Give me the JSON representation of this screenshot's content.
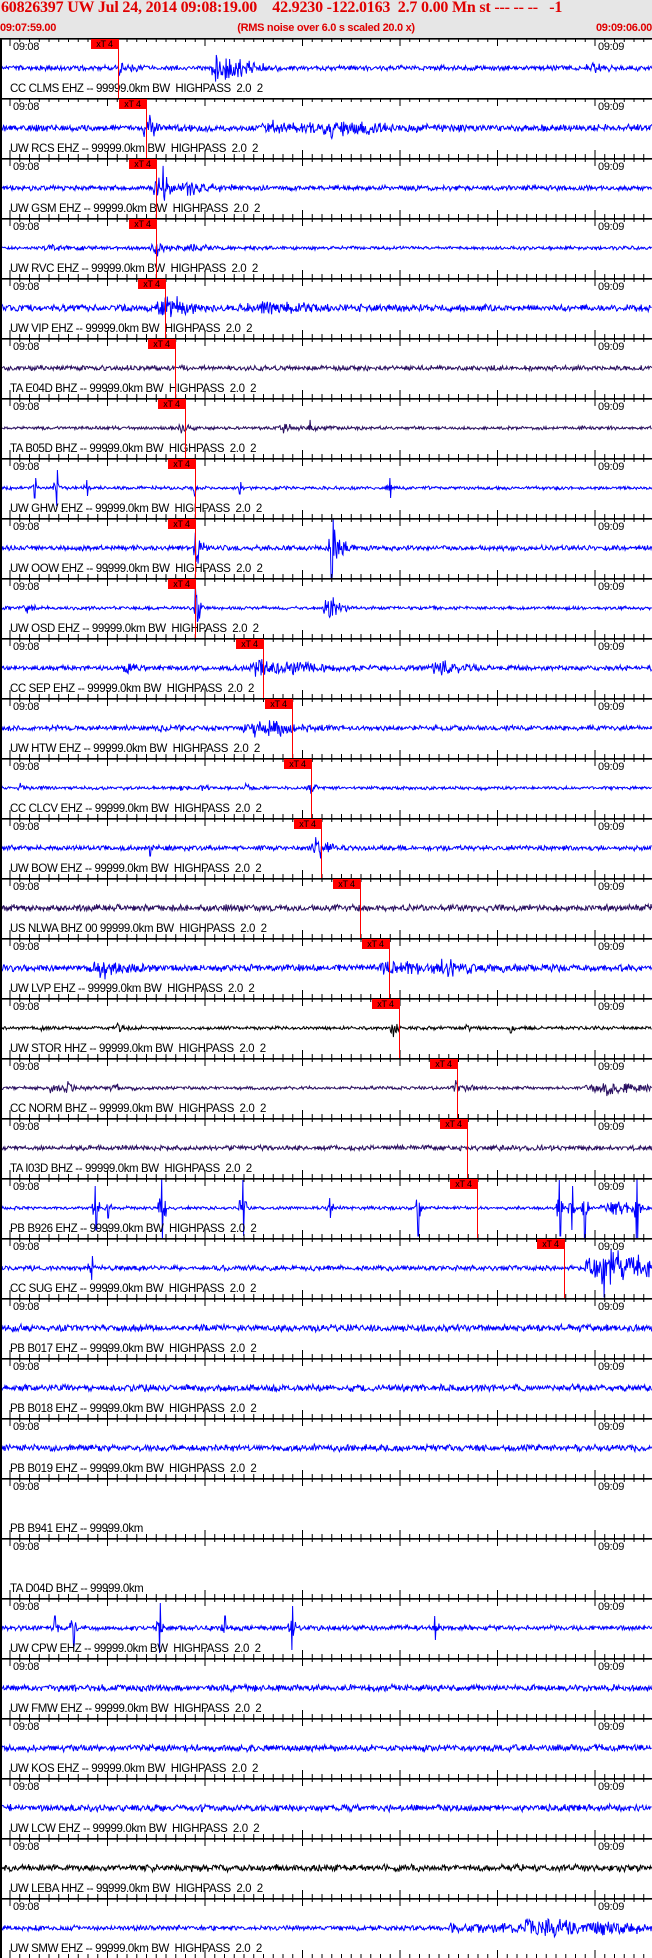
{
  "header": {
    "title": "60826397 UW Jul 24, 2014 09:08:19.00    42.9230 -122.0163  2.7 0.00 Mn st --- -- --   -1",
    "start_time": "09:07:59.00",
    "scaling_note": "(RMS noise over 6.0 s scaled 20.0 x)",
    "end_time": "09:09:06.00"
  },
  "axis": {
    "left_tick_label": "09:08",
    "right_tick_label": "09:09"
  },
  "pick_label": "xT 4",
  "colors": {
    "header_text": "#e00000",
    "header_bg": "#e6e6e6",
    "pick": "#ff0000",
    "blue_trace": "#0000ff",
    "purple_trace": "#2a1060",
    "black_trace": "#000000"
  },
  "stations": [
    {
      "label": "CC CLMS EHZ -- 99999.0km BW  HIGHPASS  2.0  2",
      "trace_color": "#0000ff",
      "pick_time": "09:08:11.1"
    },
    {
      "label": "UW RCS EHZ -- 99999.0km BW  HIGHPASS  2.0  2",
      "trace_color": "#0000ff",
      "pick_time": "09:08:14.0"
    },
    {
      "label": "UW GSM EHZ -- 99999.0km BW  HIGHPASS  2.0  2",
      "trace_color": "#0000ff",
      "pick_time": "09:08:15.0"
    },
    {
      "label": "UW RVC EHZ -- 99999.0km BW  HIGHPASS  2.0  2",
      "trace_color": "#0000ff",
      "pick_time": "09:08:15.0"
    },
    {
      "label": "UW VIP EHZ -- 99999.0km BW  HIGHPASS  2.0  2",
      "trace_color": "#0000ff",
      "pick_time": "09:08:15.9"
    },
    {
      "label": "TA E04D BHZ -- 99999.0km BW  HIGHPASS  2.0  2",
      "trace_color": "#2a1060",
      "pick_time": "09:08:16.9"
    },
    {
      "label": "TA B05D BHZ -- 99999.0km BW  HIGHPASS  2.0  2",
      "trace_color": "#2a1060",
      "pick_time": "09:08:18.0"
    },
    {
      "label": "UW GHW EHZ -- 99999.0km BW  HIGHPASS  2.0  2",
      "trace_color": "#0000ff",
      "pick_time": "09:08:19.0"
    },
    {
      "label": "UW OOW EHZ -- 99999.0km BW  HIGHPASS  2.0  2",
      "trace_color": "#0000ff",
      "pick_time": "09:08:19.0"
    },
    {
      "label": "UW OSD EHZ -- 99999.0km BW  HIGHPASS  2.0  2",
      "trace_color": "#0000ff",
      "pick_time": "09:08:19.0"
    },
    {
      "label": "CC SEP EHZ -- 99999.0km BW  HIGHPASS  2.0  2",
      "trace_color": "#0000ff",
      "pick_time": "09:08:26.0"
    },
    {
      "label": "UW HTW EHZ -- 99999.0km BW  HIGHPASS  2.0  2",
      "trace_color": "#0000ff",
      "pick_time": "09:08:28.9"
    },
    {
      "label": "CC CLCV EHZ -- 99999.0km BW  HIGHPASS  2.0  2",
      "trace_color": "#0000ff",
      "pick_time": "09:08:30.9"
    },
    {
      "label": "UW BOW EHZ -- 99999.0km BW  HIGHPASS  2.0  2",
      "trace_color": "#0000ff",
      "pick_time": "09:08:31.9"
    },
    {
      "label": "US NLWA BHZ 00 99999.0km BW  HIGHPASS  2.0  2",
      "trace_color": "#2a1060",
      "pick_time": "09:08:35.9"
    },
    {
      "label": "UW LVP EHZ -- 99999.0km BW  HIGHPASS  2.0  2",
      "trace_color": "#0000ff",
      "pick_time": "09:08:38.9"
    },
    {
      "label": "UW STOR HHZ -- 99999.0km BW  HIGHPASS  2.0  2",
      "trace_color": "#000000",
      "pick_time": "09:08:39.9"
    },
    {
      "label": "CC NORM BHZ -- 99999.0km BW  HIGHPASS  2.0  2",
      "trace_color": "#2a1060",
      "pick_time": "09:08:45.9"
    },
    {
      "label": "TA I03D BHZ -- 99999.0km BW  HIGHPASS  2.0  2",
      "trace_color": "#2a1060",
      "pick_time": "09:08:46.9"
    },
    {
      "label": "PB B926 EHZ -- 99999.0km BW  HIGHPASS  2.0  2",
      "trace_color": "#0000ff",
      "pick_time": "09:08:47.9"
    },
    {
      "label": "CC SUG EHZ -- 99999.0km BW  HIGHPASS  2.0  2",
      "trace_color": "#0000ff",
      "pick_time": "09:08:56.8"
    },
    {
      "label": "PB B017 EHZ -- 99999.0km BW  HIGHPASS  2.0  2",
      "trace_color": "#0000ff"
    },
    {
      "label": "PB B018 EHZ -- 99999.0km BW  HIGHPASS  2.0  2",
      "trace_color": "#0000ff"
    },
    {
      "label": "PB B019 EHZ -- 99999.0km BW  HIGHPASS  2.0  2",
      "trace_color": "#0000ff"
    },
    {
      "label": "PB B941 EHZ -- 99999.0km"
    },
    {
      "label": "TA D04D BHZ -- 99999.0km"
    },
    {
      "label": "UW CPW EHZ -- 99999.0km BW  HIGHPASS  2.0  2",
      "trace_color": "#0000ff"
    },
    {
      "label": "UW FMW EHZ -- 99999.0km BW  HIGHPASS  2.0  2",
      "trace_color": "#0000ff"
    },
    {
      "label": "UW KOS EHZ -- 99999.0km BW  HIGHPASS  2.0  2",
      "trace_color": "#0000ff"
    },
    {
      "label": "UW LCW EHZ -- 99999.0km BW  HIGHPASS  2.0  2",
      "trace_color": "#0000ff"
    },
    {
      "label": "UW LEBA HHZ -- 99999.0km BW  HIGHPASS  2.0  2",
      "trace_color": "#000000"
    },
    {
      "label": "UW SMW EHZ -- 99999.0km BW  HIGHPASS  2.0  2",
      "trace_color": "#0000ff"
    }
  ]
}
